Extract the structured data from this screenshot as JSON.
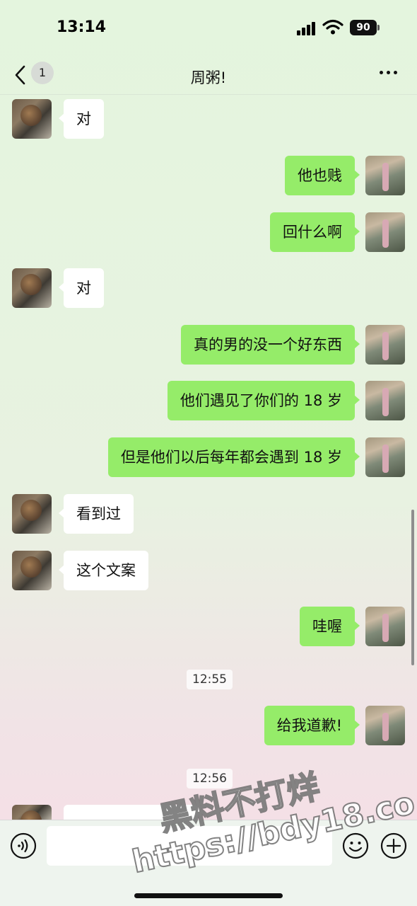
{
  "status_bar": {
    "time": "13:14",
    "battery": "90"
  },
  "nav": {
    "unread": "1",
    "title": "周粥!"
  },
  "messages": [
    {
      "side": "other",
      "text": "对"
    },
    {
      "side": "self",
      "text": "他也贱"
    },
    {
      "side": "self",
      "text": "回什么啊"
    },
    {
      "side": "other",
      "text": "对"
    },
    {
      "side": "self",
      "text": "真的男的没一个好东西"
    },
    {
      "side": "self",
      "text": "他们遇见了你们的 18 岁"
    },
    {
      "side": "self",
      "text": "但是他们以后每年都会遇到 18 岁"
    },
    {
      "side": "other",
      "text": "看到过"
    },
    {
      "side": "other",
      "text": "这个文案"
    },
    {
      "side": "self",
      "text": "哇喔"
    },
    {
      "side": "self",
      "text": "给我道歉!"
    }
  ],
  "timestamps": [
    "12:55",
    "12:56"
  ],
  "watermark": {
    "line1": "黑料不打烊",
    "line2": "https://bdy18.co"
  },
  "icons": {
    "back": "chevron-left-icon",
    "more": "more-dots-icon",
    "voice": "voice-icon",
    "emoji": "emoji-icon",
    "plus": "plus-icon"
  },
  "colors": {
    "self_bubble": "#95ec69",
    "other_bubble": "#ffffff"
  }
}
